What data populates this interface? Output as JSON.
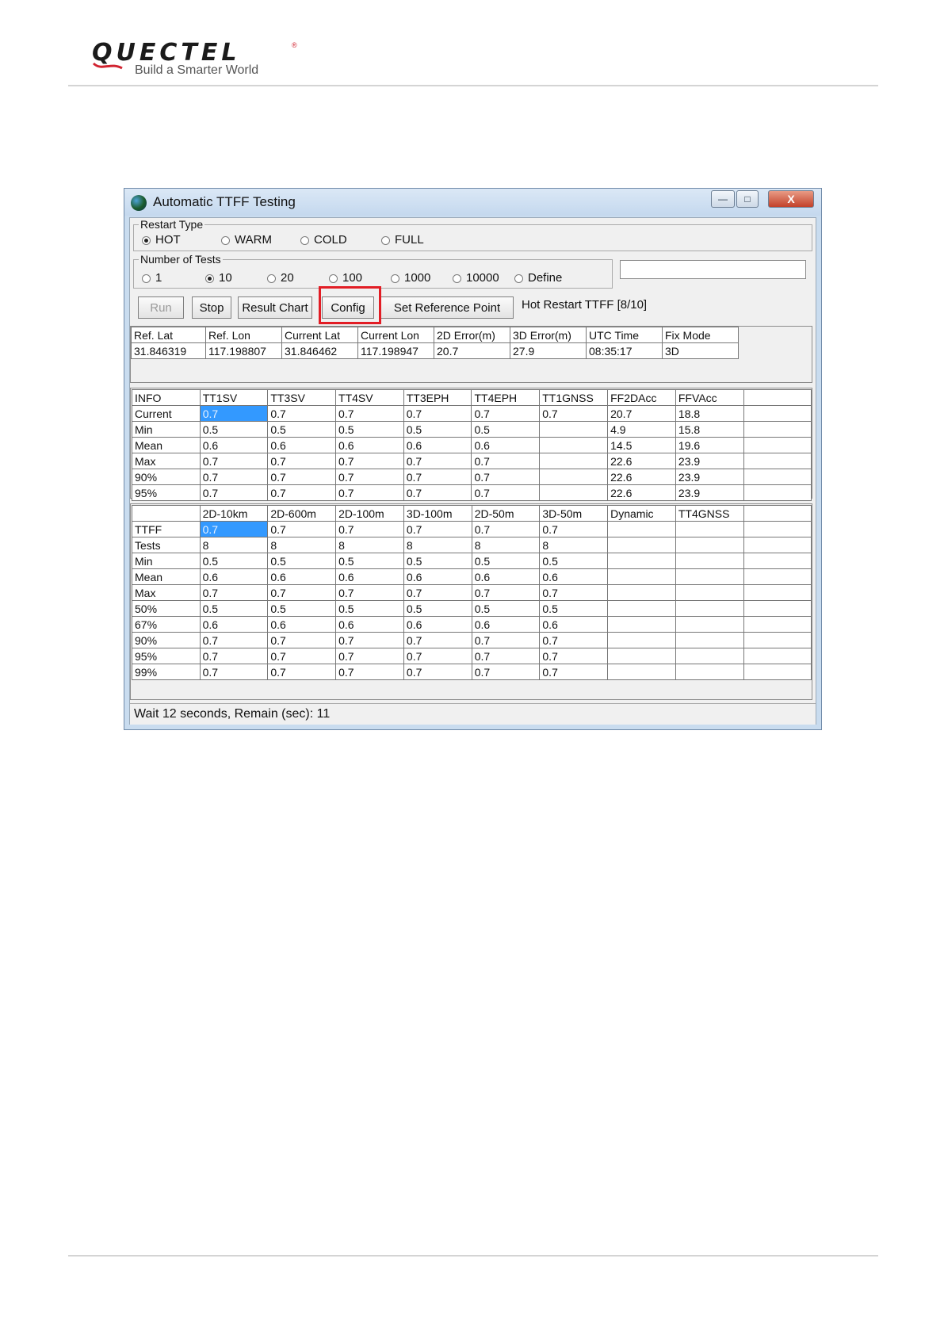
{
  "brand": {
    "name": "QUECTEL",
    "registered": "®",
    "tagline": "Build a Smarter World"
  },
  "window": {
    "title": "Automatic TTFF Testing",
    "controls": {
      "minimize": "—",
      "maximize": "□",
      "close": "X"
    }
  },
  "restart_type": {
    "label": "Restart Type",
    "options": [
      {
        "label": "HOT",
        "selected": true
      },
      {
        "label": "WARM",
        "selected": false
      },
      {
        "label": "COLD",
        "selected": false
      },
      {
        "label": "FULL",
        "selected": false
      }
    ]
  },
  "number_of_tests": {
    "label": "Number of Tests",
    "options": [
      {
        "label": "1",
        "selected": false
      },
      {
        "label": "10",
        "selected": true
      },
      {
        "label": "20",
        "selected": false
      },
      {
        "label": "100",
        "selected": false
      },
      {
        "label": "1000",
        "selected": false
      },
      {
        "label": "10000",
        "selected": false
      },
      {
        "label": "Define",
        "selected": false
      }
    ],
    "define_value": ""
  },
  "toolbar": {
    "run": "Run",
    "stop": "Stop",
    "result_chart": "Result Chart",
    "config": "Config",
    "set_reference_point": "Set Reference Point",
    "status": "Hot Restart TTFF [8/10]"
  },
  "position_table": {
    "headers": [
      "Ref. Lat",
      "Ref. Lon",
      "Current Lat",
      "Current Lon",
      "2D Error(m)",
      "3D Error(m)",
      "UTC Time",
      "Fix Mode"
    ],
    "row": [
      "31.846319",
      "117.198807",
      "31.846462",
      "117.198947",
      "20.7",
      "27.9",
      "08:35:17",
      "3D"
    ]
  },
  "info_table": {
    "headers": [
      "INFO",
      "TT1SV",
      "TT3SV",
      "TT4SV",
      "TT3EPH",
      "TT4EPH",
      "TT1GNSS",
      "FF2DAcc",
      "FFVAcc",
      ""
    ],
    "rows": [
      [
        "Current",
        "0.7",
        "0.7",
        "0.7",
        "0.7",
        "0.7",
        "0.7",
        "20.7",
        "18.8",
        ""
      ],
      [
        "Min",
        "0.5",
        "0.5",
        "0.5",
        "0.5",
        "0.5",
        "",
        "4.9",
        "15.8",
        ""
      ],
      [
        "Mean",
        "0.6",
        "0.6",
        "0.6",
        "0.6",
        "0.6",
        "",
        "14.5",
        "19.6",
        ""
      ],
      [
        "Max",
        "0.7",
        "0.7",
        "0.7",
        "0.7",
        "0.7",
        "",
        "22.6",
        "23.9",
        ""
      ],
      [
        "90%",
        "0.7",
        "0.7",
        "0.7",
        "0.7",
        "0.7",
        "",
        "22.6",
        "23.9",
        ""
      ],
      [
        "95%",
        "0.7",
        "0.7",
        "0.7",
        "0.7",
        "0.7",
        "",
        "22.6",
        "23.9",
        ""
      ]
    ]
  },
  "ttff_table": {
    "headers": [
      "",
      "2D-10km",
      "2D-600m",
      "2D-100m",
      "3D-100m",
      "2D-50m",
      "3D-50m",
      "Dynamic",
      "TT4GNSS",
      ""
    ],
    "rows": [
      [
        "TTFF",
        "0.7",
        "0.7",
        "0.7",
        "0.7",
        "0.7",
        "0.7",
        "",
        "",
        ""
      ],
      [
        "Tests",
        "8",
        "8",
        "8",
        "8",
        "8",
        "8",
        "",
        "",
        ""
      ],
      [
        "Min",
        "0.5",
        "0.5",
        "0.5",
        "0.5",
        "0.5",
        "0.5",
        "",
        "",
        ""
      ],
      [
        "Mean",
        "0.6",
        "0.6",
        "0.6",
        "0.6",
        "0.6",
        "0.6",
        "",
        "",
        ""
      ],
      [
        "Max",
        "0.7",
        "0.7",
        "0.7",
        "0.7",
        "0.7",
        "0.7",
        "",
        "",
        ""
      ],
      [
        "50%",
        "0.5",
        "0.5",
        "0.5",
        "0.5",
        "0.5",
        "0.5",
        "",
        "",
        ""
      ],
      [
        "67%",
        "0.6",
        "0.6",
        "0.6",
        "0.6",
        "0.6",
        "0.6",
        "",
        "",
        ""
      ],
      [
        "90%",
        "0.7",
        "0.7",
        "0.7",
        "0.7",
        "0.7",
        "0.7",
        "",
        "",
        ""
      ],
      [
        "95%",
        "0.7",
        "0.7",
        "0.7",
        "0.7",
        "0.7",
        "0.7",
        "",
        "",
        ""
      ],
      [
        "99%",
        "0.7",
        "0.7",
        "0.7",
        "0.7",
        "0.7",
        "0.7",
        "",
        "",
        ""
      ]
    ]
  },
  "status_bar": "Wait 12 seconds, Remain (sec): 11",
  "colors": {
    "highlight": "#e21d25",
    "selection": "#3399ff",
    "titlebar": "#c9dcef"
  }
}
